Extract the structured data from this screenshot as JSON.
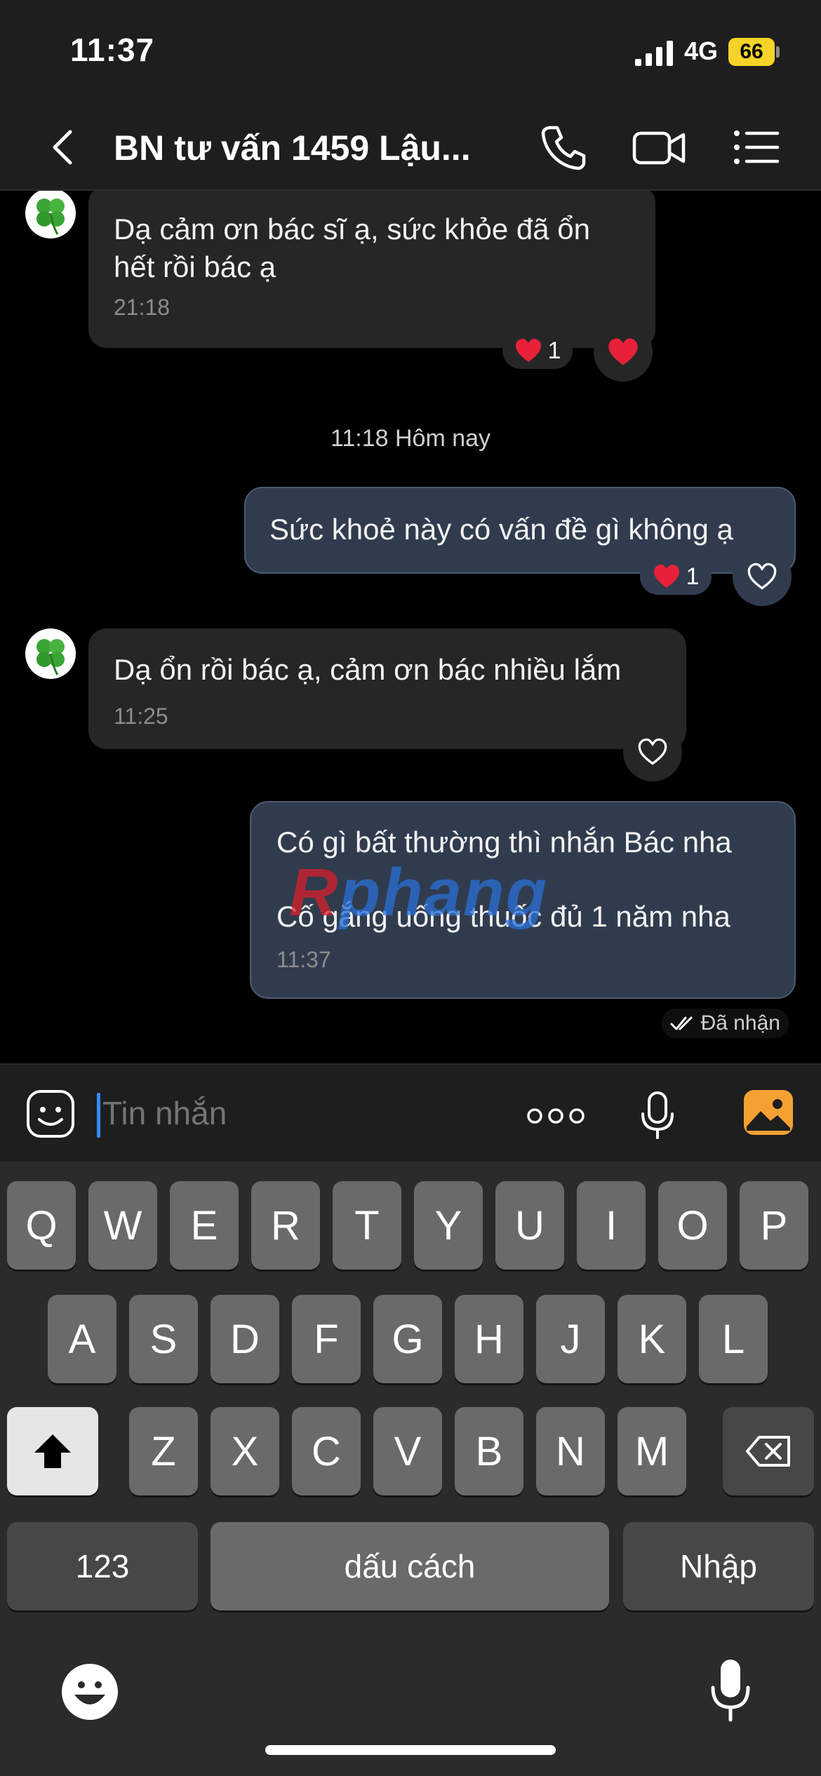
{
  "status": {
    "time": "11:37",
    "network": "4G",
    "battery": "66"
  },
  "header": {
    "title": "BN tư vấn 1459 Lậu...",
    "icons": [
      "back-arrow-icon",
      "phone-icon",
      "video-call-icon",
      "menu-list-icon"
    ]
  },
  "messages": [
    {
      "direction": "incoming",
      "lines": [
        "Dạ cảm ơn bác sĩ ạ, sức khỏe đã ổn",
        "hết rồi bác ạ"
      ],
      "time": "21:18",
      "reaction": {
        "emoji": "heart",
        "count": "1"
      },
      "my_reaction": "heart-filled"
    },
    {
      "direction": "outgoing",
      "lines": [
        "Sức khoẻ này có vấn đề gì không ạ"
      ],
      "reaction": {
        "emoji": "heart",
        "count": "1"
      },
      "my_reaction": "heart-outline"
    },
    {
      "direction": "incoming",
      "lines": [
        "Dạ ổn rồi bác ạ, cảm ơn bác nhiều lắm"
      ],
      "time": "11:25",
      "my_reaction": "heart-outline"
    },
    {
      "direction": "outgoing",
      "lines": [
        "Có gì bất thường thì nhắn Bác nha",
        "Cố gắng uống thuốc đủ 1 năm nha"
      ],
      "time": "11:37"
    }
  ],
  "date_separator": "11:18 Hôm nay",
  "delivery_status": "Đã nhận",
  "watermark": {
    "first": "R",
    "rest": "phang"
  },
  "composer": {
    "placeholder": "Tin nhắn"
  },
  "keyboard": {
    "row1": [
      "Q",
      "W",
      "E",
      "R",
      "T",
      "Y",
      "U",
      "I",
      "O",
      "P"
    ],
    "row2": [
      "A",
      "S",
      "D",
      "F",
      "G",
      "H",
      "J",
      "K",
      "L"
    ],
    "row3": [
      "Z",
      "X",
      "C",
      "V",
      "B",
      "N",
      "M"
    ],
    "numbers_key": "123",
    "space_key": "dấu cách",
    "enter_key": "Nhập"
  },
  "colors": {
    "incoming_bubble": "#262626",
    "outgoing_bubble": "#303c4e",
    "battery": "#f5d328",
    "accent": "#2f8cff",
    "gallery": "#f4a033",
    "heart": "#e8213a"
  }
}
